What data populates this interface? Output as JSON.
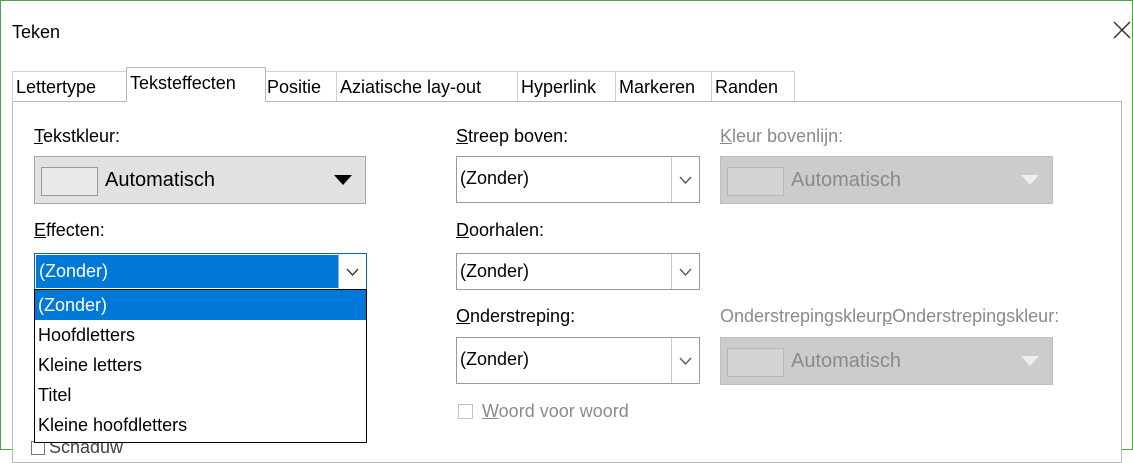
{
  "window": {
    "title": "Teken",
    "close_icon": "close-icon"
  },
  "tabs": [
    {
      "label": "Lettertype",
      "active": false
    },
    {
      "label": "Teksteffecten",
      "active": true
    },
    {
      "label": "Positie",
      "active": false
    },
    {
      "label": "Aziatische lay-out",
      "active": false
    },
    {
      "label": "Hyperlink",
      "active": false
    },
    {
      "label": "Markeren",
      "active": false
    },
    {
      "label": "Randen",
      "active": false
    }
  ],
  "font_color": {
    "label": "Tekstkleur:",
    "value": "Automatisch"
  },
  "effects": {
    "label": "Effecten:",
    "value": "(Zonder)",
    "options": [
      "(Zonder)",
      "Hoofdletters",
      "Kleine letters",
      "Titel",
      "Kleine hoofdletters"
    ],
    "selected_index": 0
  },
  "overline": {
    "label": "Streep boven:",
    "value": "(Zonder)"
  },
  "overline_color": {
    "label": "Kleur bovenlijn:",
    "value": "Automatisch",
    "enabled": false
  },
  "strikethrough": {
    "label": "Doorhalen:",
    "value": "(Zonder)"
  },
  "underline": {
    "label": "Onderstreping:",
    "value": "(Zonder)"
  },
  "underline_color": {
    "label": "Onderstrepingskleur:",
    "value": "Automatisch",
    "enabled": false
  },
  "word_by_word": {
    "label": "Woord voor woord",
    "checked": false,
    "enabled": false
  },
  "shadow": {
    "label": "Schaduw"
  },
  "colors": {
    "accent": "#0078d7",
    "window_border": "#4aa54a",
    "disabled_text": "#8a8a8a"
  }
}
